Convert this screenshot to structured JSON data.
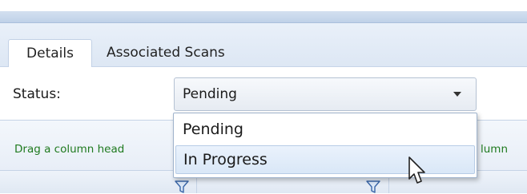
{
  "tabs": [
    {
      "label": "Details",
      "active": true
    },
    {
      "label": "Associated Scans",
      "active": false
    }
  ],
  "status": {
    "label": "Status:",
    "selected": "Pending",
    "options": [
      "Pending",
      "In Progress"
    ],
    "hovered_option": "In Progress"
  },
  "grid": {
    "group_hint_left": "Drag a column head",
    "group_hint_right": "lumn"
  },
  "colors": {
    "hint_text": "#1f7a1f",
    "header_bar": "#bfd1e8",
    "hover_bg": "#d9e7f7"
  },
  "icons": [
    "filter-icon",
    "filter-icon",
    "mouse-cursor-icon",
    "chevron-down-icon"
  ]
}
